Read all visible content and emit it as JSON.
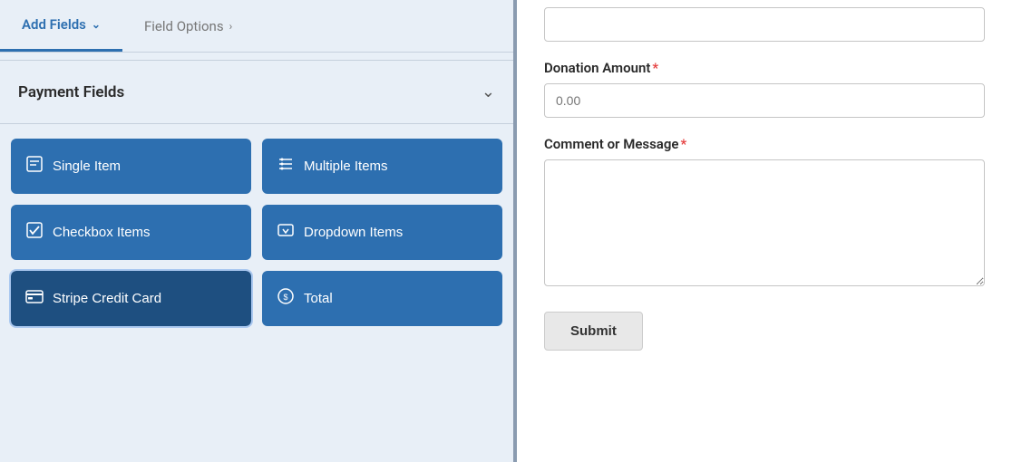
{
  "tabs": {
    "add_fields": {
      "label": "Add Fields",
      "chevron": "∨",
      "active": true
    },
    "field_options": {
      "label": "Field Options",
      "chevron": ">",
      "active": false
    }
  },
  "payment_fields": {
    "section_title": "Payment Fields",
    "chevron": "∨",
    "buttons": [
      {
        "id": "single-item",
        "label": "Single Item",
        "icon": "📄"
      },
      {
        "id": "multiple-items",
        "label": "Multiple Items",
        "icon": "☰"
      },
      {
        "id": "checkbox-items",
        "label": "Checkbox Items",
        "icon": "☑"
      },
      {
        "id": "dropdown-items",
        "label": "Dropdown Items",
        "icon": "⊡"
      },
      {
        "id": "stripe-credit-card",
        "label": "Stripe Credit Card",
        "icon": "💳",
        "active": true
      },
      {
        "id": "total",
        "label": "Total",
        "icon": "⊙"
      }
    ]
  },
  "form": {
    "donation_amount": {
      "label": "Donation Amount",
      "required": true,
      "placeholder": "0.00"
    },
    "comment_or_message": {
      "label": "Comment or Message",
      "required": true,
      "placeholder": ""
    },
    "submit_button": "Submit"
  }
}
